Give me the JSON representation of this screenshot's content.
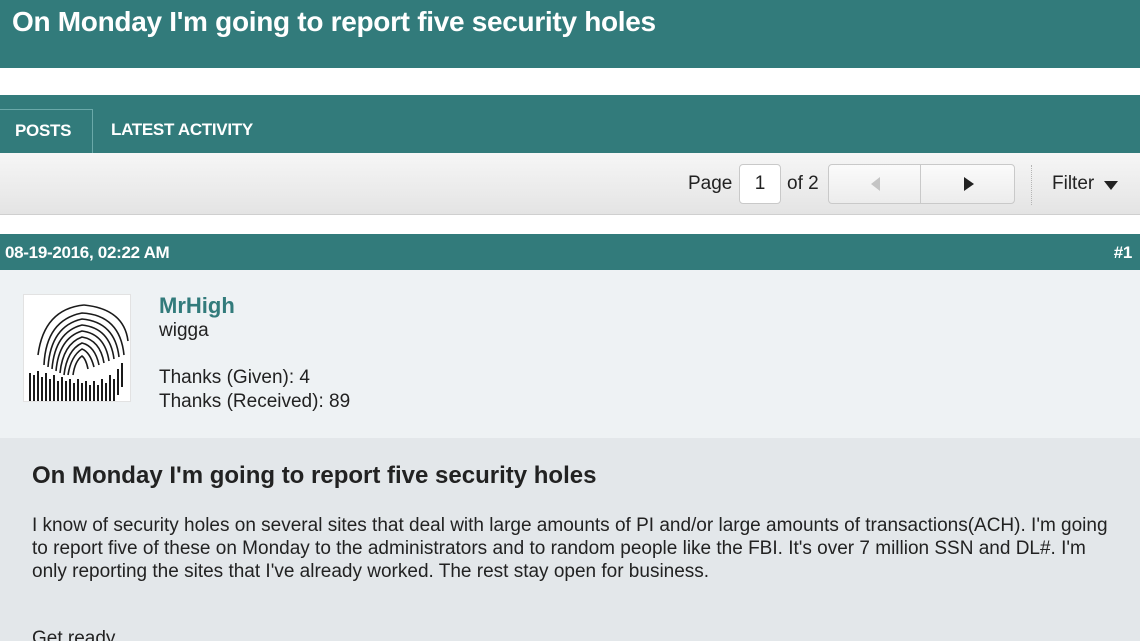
{
  "thread": {
    "title": "On Monday I'm going to report five security holes"
  },
  "tabs": [
    {
      "label": "POSTS"
    },
    {
      "label": "LATEST ACTIVITY"
    }
  ],
  "pagination": {
    "page_label": "Page",
    "current_page": "1",
    "of_label": "of 2"
  },
  "filter": {
    "label": "Filter"
  },
  "post": {
    "date": "08-19-2016, 02:22 AM",
    "number": "#1",
    "author": {
      "username": "MrHigh",
      "usertitle": "wigga",
      "thanks_given": "Thanks (Given): 4",
      "thanks_received": "Thanks (Received): 89",
      "avatar_icon": "fingerprint-avatar-icon"
    },
    "title": "On Monday I'm going to report five security holes",
    "body": "I know of security holes on several sites that deal with large amounts of PI and/or large amounts of transactions(ACH). I'm going to report five of these on Monday to the administrators and to random people like the FBI. It's over 7 million SSN and DL#. I'm only reporting the sites that I've already worked. The rest stay open for business.",
    "body_line2": "Get ready."
  },
  "colors": {
    "accent": "#327b7b",
    "author_panel": "#eef2f4",
    "post_body": "#e3e7ea"
  }
}
